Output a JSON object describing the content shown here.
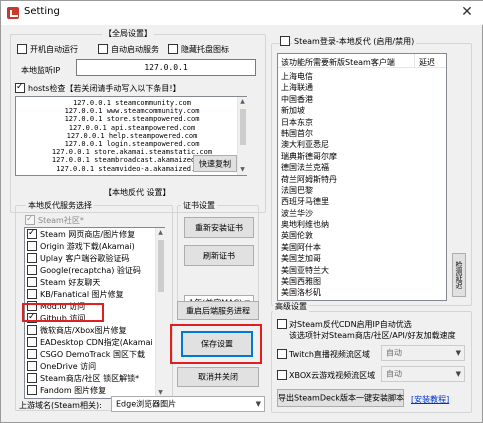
{
  "window": {
    "title": "Setting",
    "close_glyph": "✕"
  },
  "global": {
    "group_label": "【全局设置】",
    "startup_label": "开机自动运行",
    "autostart_service_label": "自动启动服务",
    "hide_tray_label": "隐藏托盘图标",
    "listen_ip_label": "本地监听IP",
    "listen_ip_value": "127.0.0.1",
    "hosts_check_label": "hosts检查【若关闭请手动写入以下条目!】",
    "hosts_lines": [
      "127.0.0.1 steamcommunity.com",
      "127.0.0.1 www.steamcommunity.com",
      "127.0.0.1 store.steampowered.com",
      "127.0.0.1 api.steampowered.com",
      "127.0.0.1 help.steampowered.com",
      "127.0.0.1 login.steampowered.com",
      "127.0.0.1 store.akamai.steamstatic.com",
      "127.0.0.1 steambroadcast.akamaized.net",
      "127.0.0.1 steamvideo-a.akamaized.net"
    ],
    "quick_copy_label": "快速复制"
  },
  "local_proxy": {
    "group_label": "【本地反代 设置】",
    "service_select_label": "本地反代服务选择",
    "steam_community_label": "Steam社区*",
    "services": [
      {
        "label": "Steam 网页商店/图片修复",
        "checked": true
      },
      {
        "label": "Origin 游戏下载(Akamai)",
        "checked": false
      },
      {
        "label": "Uplay 客户端谷歌验证码",
        "checked": false
      },
      {
        "label": "Google(recaptcha) 验证码",
        "checked": false
      },
      {
        "label": "Steam 好友聊天",
        "checked": false
      },
      {
        "label": "KB/Fanatical 图片修复",
        "checked": false
      },
      {
        "label": "Mod.io 访问",
        "checked": false
      },
      {
        "label": "Github 访问",
        "checked": true
      },
      {
        "label": "微软商店/Xbox图片修复",
        "checked": false
      },
      {
        "label": "EADesktop CDN指定(Akamai",
        "checked": false
      },
      {
        "label": "CSGO DemoTrack 国区下载",
        "checked": false
      },
      {
        "label": "OneDrive 访问",
        "checked": false
      },
      {
        "label": "Steam商店/社区 锁区解锁*",
        "checked": false
      },
      {
        "label": "Fandom 图片修复",
        "checked": false
      }
    ],
    "upstream_label": "上游域名(Steam相关):",
    "upstream_value": "Edge浏览器图片"
  },
  "cert": {
    "group_label": "证书设置",
    "regen_label": "重新安装证书",
    "refresh_label": "刷新证书",
    "validity_value": "1年(兼容MAC)"
  },
  "actions": {
    "restart_label": "重启后端服务进程",
    "save_label": "保存设置",
    "cancel_label": "取消并关闭"
  },
  "steam_login": {
    "group_label": "Steam登录-本地反代 (启用/禁用)",
    "col_server": "该功能所需要新版Steam客户端",
    "col_latency": "延迟",
    "servers": [
      "上海电信",
      "上海联通",
      "中国香港",
      "新加坡",
      "日本东京",
      "韩国首尔",
      "澳大利亚悉尼",
      "瑞典斯德哥尔摩",
      "德国法兰克福",
      "荷兰阿姆斯特丹",
      "法国巴黎",
      "西班牙马德里",
      "波兰华沙",
      "奥地利维也纳",
      "英国伦敦",
      "美国阿什本",
      "美国芝加哥",
      "美国亚特兰大",
      "美国西雅图",
      "美国洛杉矶"
    ],
    "detect_button": "检测延迟"
  },
  "advanced": {
    "group_label": "高级设置",
    "cdn_label_line1": "对Steam反代CDN启用IP自动优选",
    "cdn_label_line2": "该选项针对Steam商店/社区/API/好友加载速度",
    "twitch_label": "Twitch直播视频流区域",
    "twitch_value": "自动",
    "xbox_label": "XBOX云游戏视频流区域",
    "xbox_value": "自动",
    "export_label": "导出SteamDeck版本一键安装脚本",
    "tutorial_link": "[安装教程]"
  }
}
